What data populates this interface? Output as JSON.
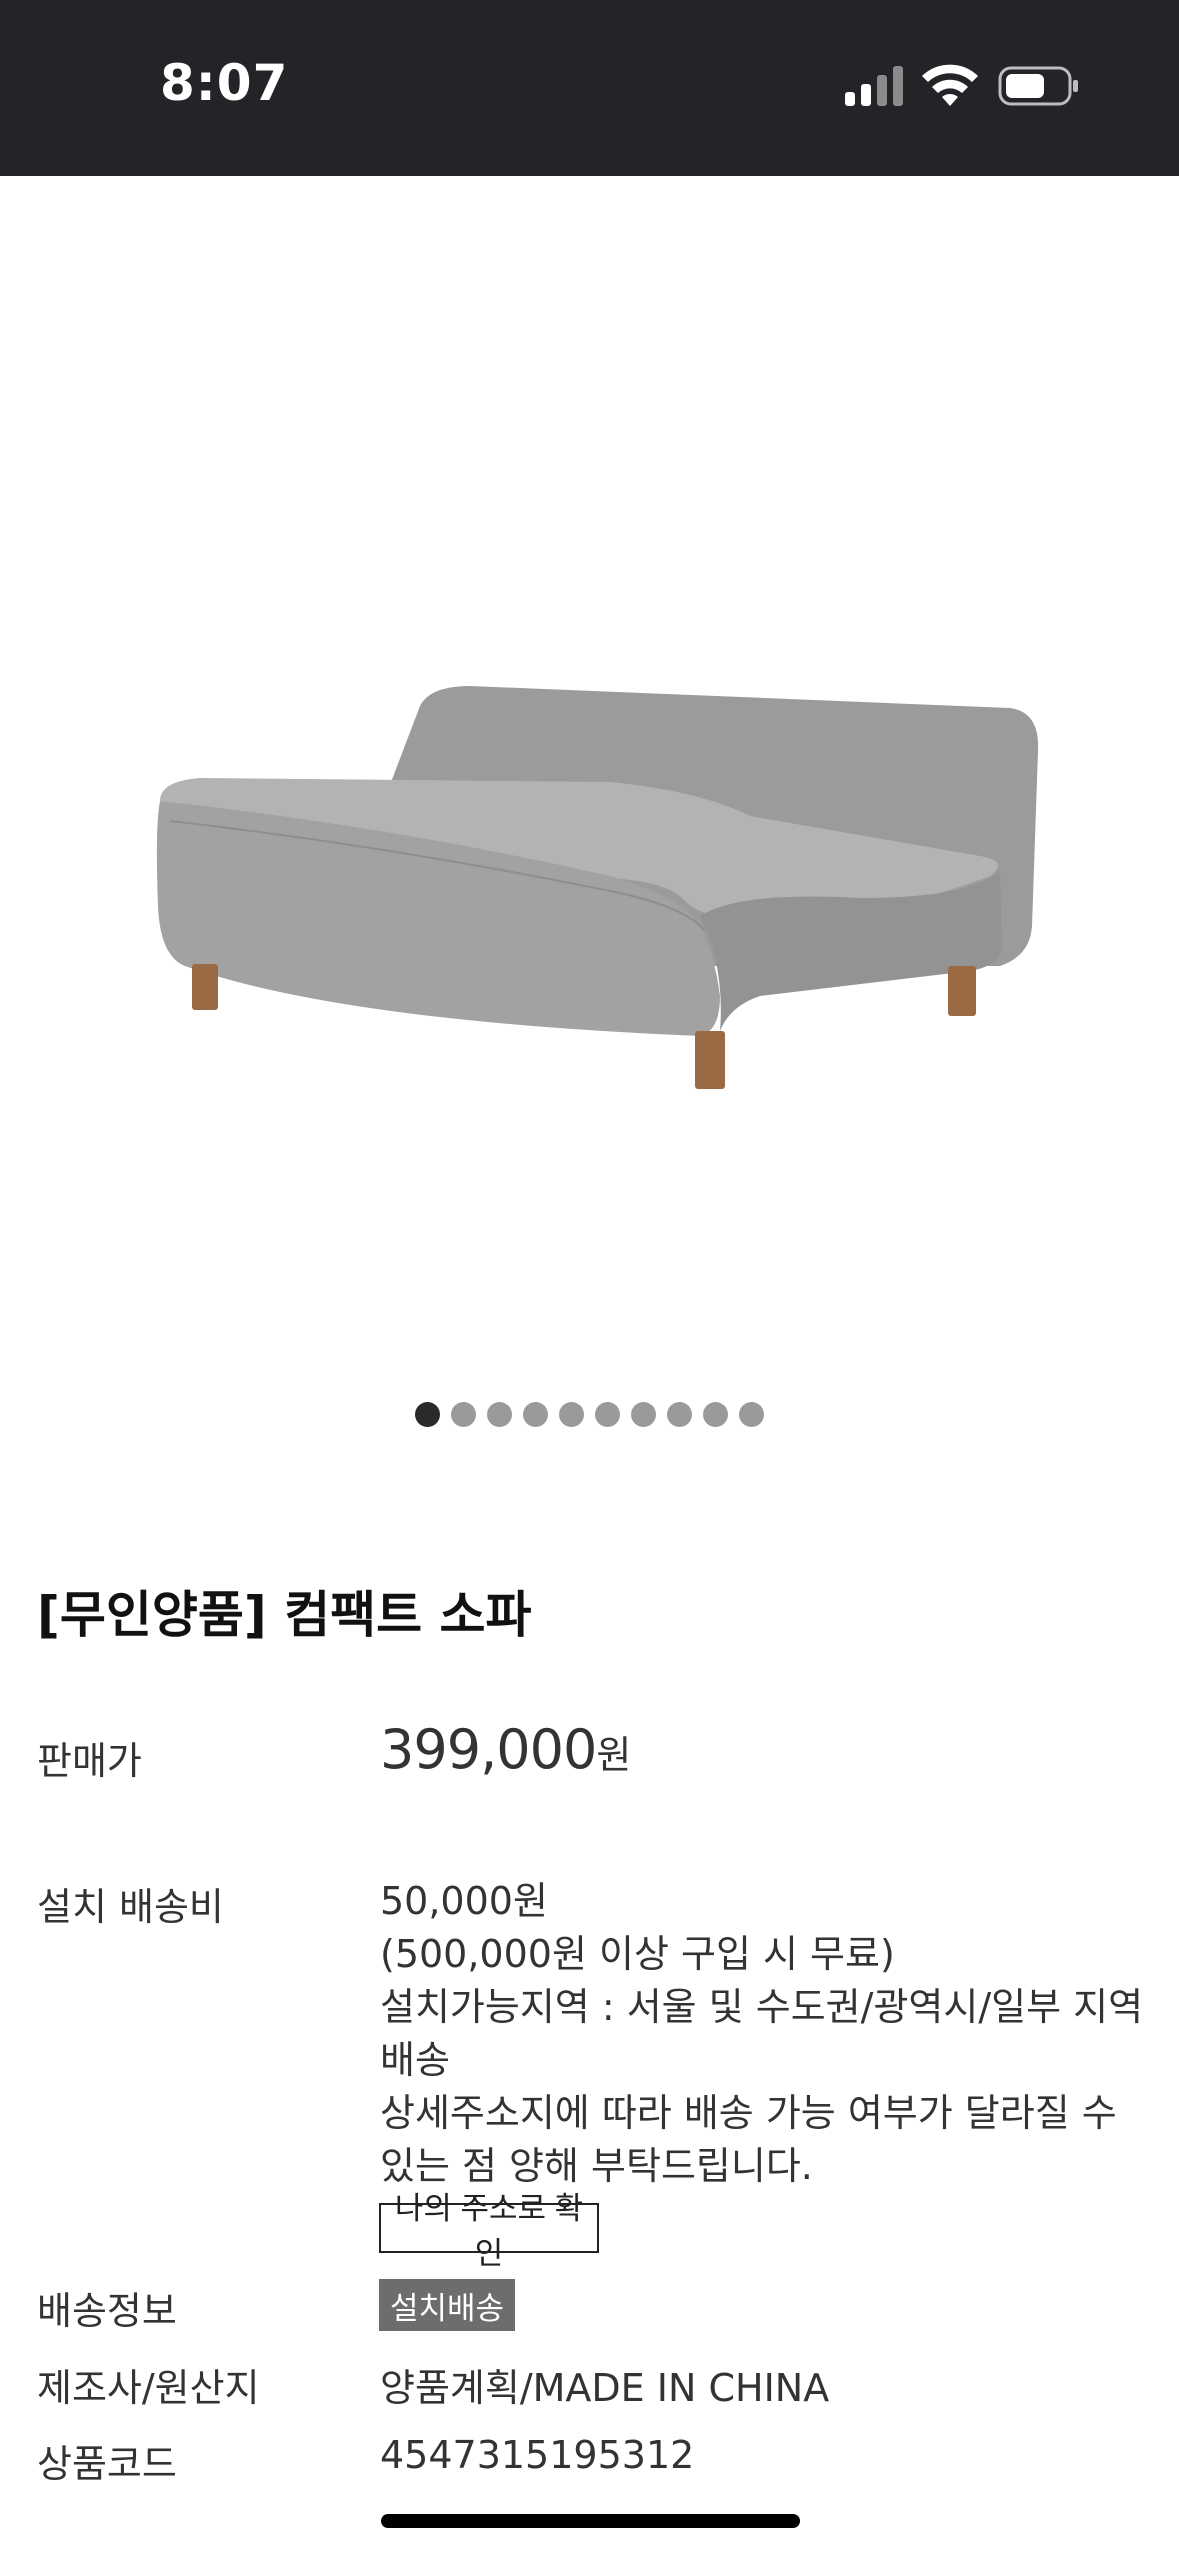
{
  "status_bar": {
    "time": "8:07",
    "icons": [
      "cellular-signal-icon",
      "wifi-icon",
      "battery-icon"
    ]
  },
  "carousel": {
    "total_pages": 10,
    "current_page": 1
  },
  "product": {
    "title": "[무인양품] 컴팩트 소파",
    "price_label": "판매가",
    "price_value": "399,000",
    "price_unit": "원",
    "shipping_fee_label": "설치 배송비",
    "shipping_fee_lines": [
      "50,000원",
      "(500,000원 이상 구입 시 무료)",
      "설치가능지역 : 서울 및 수도권/광역시/일부 지역배송",
      "상세주소지에 따라 배송 가능 여부가 달라질 수 있는 점 양해 부탁드립니다."
    ],
    "address_check_button": "나의 주소로 확인",
    "delivery_info_label": "배송정보",
    "delivery_badge": "설치배송",
    "manufacturer_label": "제조사/원산지",
    "manufacturer_value": "양품계획/MADE IN CHINA",
    "product_code_label": "상품코드",
    "product_code_value": "4547315195312"
  },
  "colors": {
    "status_bar_bg": "#232427",
    "sofa_fabric": "#a7a7a7",
    "sofa_legs": "#9a6a45",
    "badge_bg": "#6d6d6d"
  }
}
